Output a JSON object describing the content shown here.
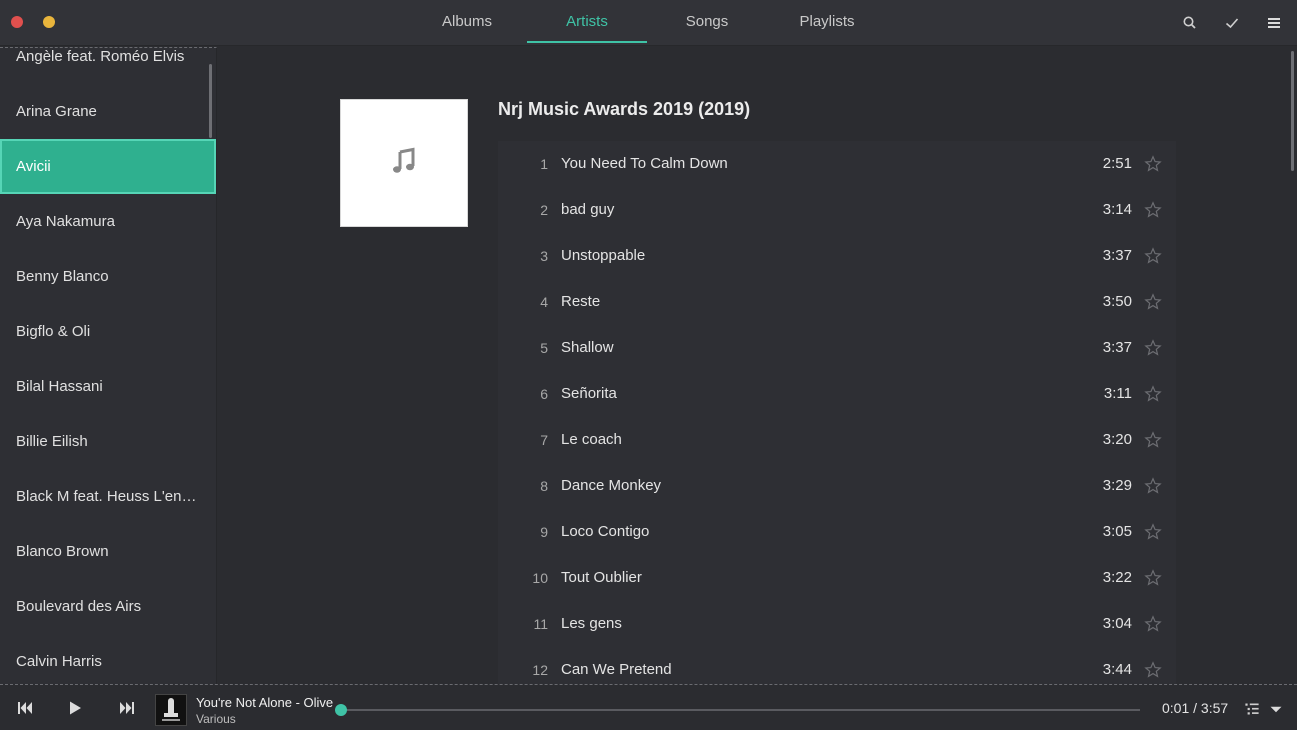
{
  "window": {
    "close_color": "#e0504e",
    "minimize_color": "#e9b53c"
  },
  "tabs": [
    {
      "label": "Albums",
      "active": false
    },
    {
      "label": "Artists",
      "active": true
    },
    {
      "label": "Songs",
      "active": false
    },
    {
      "label": "Playlists",
      "active": false
    }
  ],
  "header_icons": [
    "search-icon",
    "checkmark-icon",
    "hamburger-menu-icon"
  ],
  "accent_color": "#3fc3a6",
  "sidebar": {
    "artists": [
      {
        "name": "Angèle feat. Roméo Elvis",
        "selected": false
      },
      {
        "name": "Arina Grane",
        "selected": false
      },
      {
        "name": "Avicii",
        "selected": true
      },
      {
        "name": "Aya Nakamura",
        "selected": false
      },
      {
        "name": "Benny Blanco",
        "selected": false
      },
      {
        "name": "Bigflo & Oli",
        "selected": false
      },
      {
        "name": "Bilal Hassani",
        "selected": false
      },
      {
        "name": "Billie Eilish",
        "selected": false
      },
      {
        "name": "Black M feat. Heuss L'enfoiré…",
        "selected": false
      },
      {
        "name": "Blanco Brown",
        "selected": false
      },
      {
        "name": "Boulevard des Airs",
        "selected": false
      },
      {
        "name": "Calvin Harris",
        "selected": false
      }
    ]
  },
  "album": {
    "title": "Nrj Music Awards 2019 (2019)",
    "art_icon": "music-note-icon",
    "tracks": [
      {
        "num": "1",
        "title": "You Need To Calm Down",
        "duration": "2:51"
      },
      {
        "num": "2",
        "title": "bad guy",
        "duration": "3:14"
      },
      {
        "num": "3",
        "title": "Unstoppable",
        "duration": "3:37"
      },
      {
        "num": "4",
        "title": "Reste",
        "duration": "3:50"
      },
      {
        "num": "5",
        "title": "Shallow",
        "duration": "3:37"
      },
      {
        "num": "6",
        "title": "Señorita",
        "duration": "3:11"
      },
      {
        "num": "7",
        "title": "Le coach",
        "duration": "3:20"
      },
      {
        "num": "8",
        "title": "Dance Monkey",
        "duration": "3:29"
      },
      {
        "num": "9",
        "title": "Loco Contigo",
        "duration": "3:05"
      },
      {
        "num": "10",
        "title": "Tout Oublier",
        "duration": "3:22"
      },
      {
        "num": "11",
        "title": "Les gens",
        "duration": "3:04"
      },
      {
        "num": "12",
        "title": "Can We Pretend",
        "duration": "3:44"
      }
    ]
  },
  "player": {
    "title": "You're Not Alone - Olive",
    "artist": "Various",
    "time_display": "0:01 / 3:57",
    "progress_fraction": 0.004,
    "controls": [
      "previous-icon",
      "play-icon",
      "next-icon"
    ],
    "right_icons": [
      "queue-icon",
      "dropdown-icon"
    ]
  }
}
